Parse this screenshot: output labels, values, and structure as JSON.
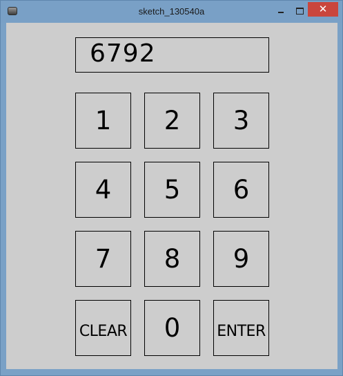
{
  "window": {
    "title": "sketch_130540a",
    "close_label": "✕"
  },
  "display": {
    "value": "6792"
  },
  "keypad": {
    "keys": [
      "1",
      "2",
      "3",
      "4",
      "5",
      "6",
      "7",
      "8",
      "9",
      "CLEAR",
      "0",
      "ENTER"
    ]
  }
}
